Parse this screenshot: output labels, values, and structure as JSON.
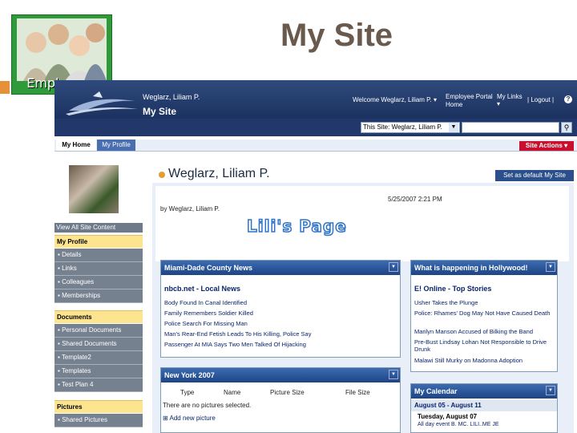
{
  "slide": {
    "title": "My Site",
    "logo_caption": "Employees"
  },
  "topbar": {
    "user": "Weglarz, Liliam P.",
    "site_name": "My Site",
    "welcome": "Welcome Weglarz, Liliam P.",
    "links": [
      "Employee Portal",
      "Home"
    ],
    "my_links": "My Links",
    "logout": "Logout",
    "help": "?"
  },
  "search": {
    "scope": "This Site: Weglarz, Liliam P.",
    "search_icon": "magnifier-icon"
  },
  "tabs": {
    "my_home": "My Home",
    "my_profile": "My Profile",
    "site_actions": "Site Actions ▾"
  },
  "leftnav": {
    "view_all": "View All Site Content",
    "sections": [
      {
        "label": "My Profile",
        "items": [
          "Details",
          "Links",
          "Colleagues",
          "Memberships"
        ]
      },
      {
        "label": "Documents",
        "items": [
          "Personal Documents",
          "Shared Documents",
          "Template2",
          "Templates",
          "Test Plan 4"
        ]
      },
      {
        "label": "Pictures",
        "items": [
          "Shared Pictures"
        ]
      }
    ]
  },
  "main": {
    "title": "Weglarz, Liliam P.",
    "set_default": "Set as default My Site",
    "byline": "by Weglarz, Liliam P.",
    "date": "5/25/2007 2:21 PM",
    "banner": "Lili's Page"
  },
  "webparts": {
    "miami": {
      "title": "Miami-Dade County News",
      "source": "nbcb.net - Local News",
      "items": [
        "Body Found In Canal Identified",
        "Family Remembers Soldier Killed",
        "Police Search For Missing Man",
        "Man's Rear-End Fetish Leads To His Killing, Police Say",
        "Passenger At MIA Says Two Men Talked Of Hijacking"
      ]
    },
    "hollywood": {
      "title": "What is happening in Hollywood!",
      "source": "E! Online - Top Stories",
      "items": [
        "Usher Takes the Plunge",
        "Police: Rhames' Dog May Not Have Caused Death",
        "Marilyn Manson Accused of Bilking the Band",
        "Pre-Bust Lindsay Lohan Not Responsible to Drive Drunk",
        "Malawi Still Murky on Madonna Adoption"
      ]
    },
    "newyork": {
      "title": "New York 2007",
      "columns": [
        "Type",
        "Name",
        "Picture Size",
        "File Size"
      ],
      "empty": "There are no pictures selected.",
      "add": "Add new picture"
    },
    "calendar": {
      "title": "My Calendar",
      "range": "August 05 - August 11",
      "day": "Tuesday, August 07",
      "event": "All day event     B. MC.  LILI..ME  JE"
    }
  }
}
